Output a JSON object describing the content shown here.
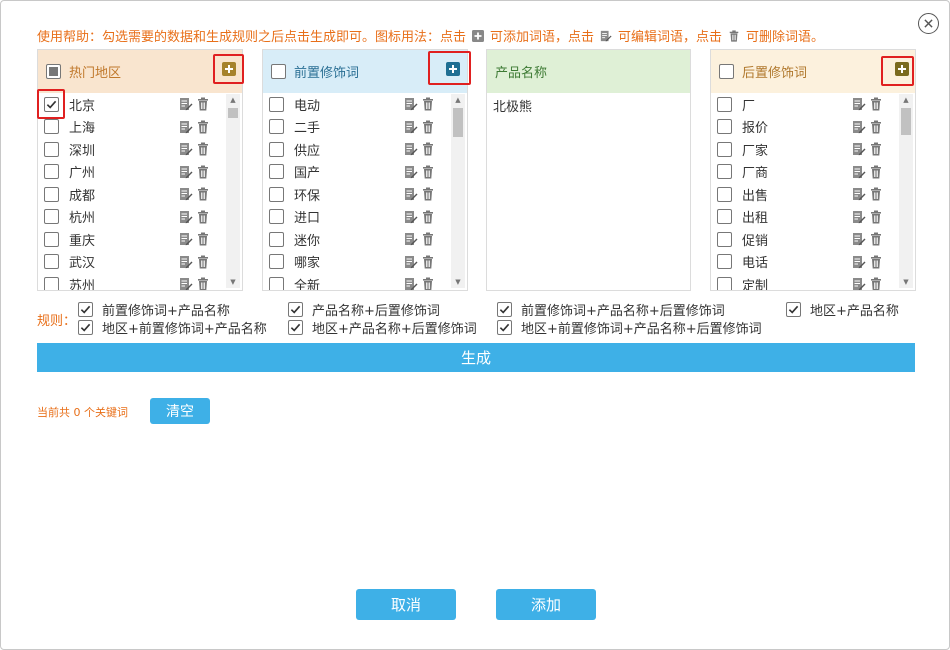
{
  "help_text": {
    "prefix": "使用帮助：勾选需要的数据和生成规则之后点击生成即可。图标用法：点击",
    "add_text": "可添加词语，点击",
    "edit_text": "可编辑词语，点击",
    "delete_text": "可删除词语。"
  },
  "panels": {
    "region": {
      "title": "热门地区",
      "header_bg": "#f9e5cf",
      "items": [
        "北京",
        "上海",
        "深圳",
        "广州",
        "成都",
        "杭州",
        "重庆",
        "武汉",
        "苏州"
      ],
      "checked": [
        true,
        false,
        false,
        false,
        false,
        false,
        false,
        false,
        false
      ],
      "scroll_thumb_fraction": 0.06
    },
    "prefix": {
      "title": "前置修饰词",
      "header_bg": "#d8edf8",
      "items": [
        "电动",
        "二手",
        "供应",
        "国产",
        "环保",
        "进口",
        "迷你",
        "哪家",
        "全新"
      ],
      "checked": [
        false,
        false,
        false,
        false,
        false,
        false,
        false,
        false,
        false
      ],
      "scroll_thumb_fraction": 0.17
    },
    "product": {
      "title": "产品名称",
      "header_bg": "#dff0d6",
      "items": [
        "北极熊"
      ]
    },
    "suffix": {
      "title": "后置修饰词",
      "header_bg": "#fcf1dd",
      "items": [
        "厂",
        "报价",
        "厂家",
        "厂商",
        "出售",
        "出租",
        "促销",
        "电话",
        "定制"
      ],
      "checked": [
        false,
        false,
        false,
        false,
        false,
        false,
        false,
        false,
        false
      ],
      "scroll_thumb_fraction": 0.16
    }
  },
  "rules": {
    "label": "规则：",
    "items": [
      {
        "label": "前置修饰词+产品名称",
        "checked": true
      },
      {
        "label": "产品名称+后置修饰词",
        "checked": true
      },
      {
        "label": "前置修饰词+产品名称+后置修饰词",
        "checked": true
      },
      {
        "label": "地区+产品名称",
        "checked": true
      },
      {
        "label": "地区+前置修饰词+产品名称",
        "checked": true
      },
      {
        "label": "地区+产品名称+后置修饰词",
        "checked": true
      },
      {
        "label": "地区+前置修饰词+产品名称+后置修饰词",
        "checked": true
      }
    ]
  },
  "generate_label": "生成",
  "count_text": "当前共 0 个关键词",
  "clear_label": "清空",
  "cancel_label": "取消",
  "add_label": "添加",
  "colors": {
    "accent": "#3eb0e7",
    "warning_text": "#e86f19",
    "highlight_box": "#e02020",
    "plus_brown": "#a6822c",
    "plus_blue": "#1f6f93"
  },
  "icons": {
    "close": "close-icon",
    "add": "plus-square-icon",
    "edit": "edit-icon",
    "delete": "trash-icon"
  }
}
